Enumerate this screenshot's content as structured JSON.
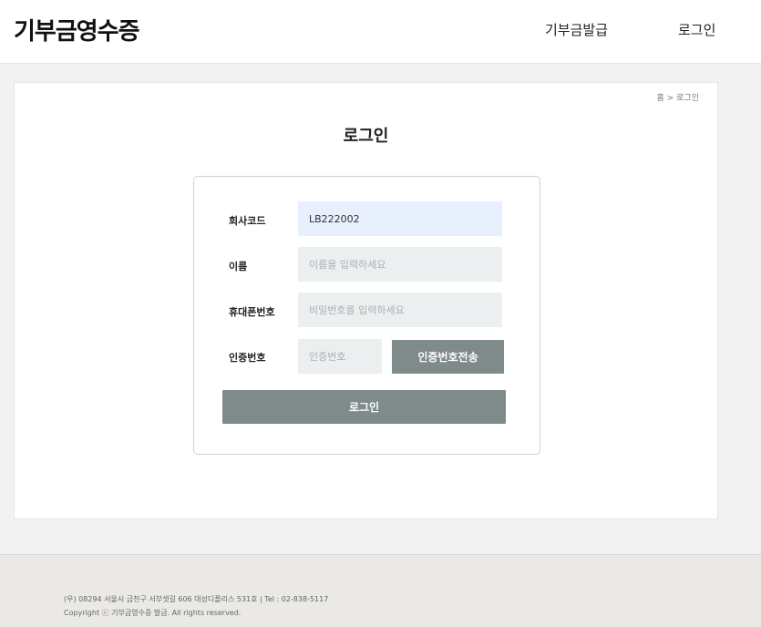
{
  "header": {
    "logo": "기부금영수증",
    "nav": {
      "issue": "기부금발급",
      "login": "로그인"
    }
  },
  "breadcrumb": "홈 > 로그인",
  "page_title": "로그인",
  "form": {
    "company_code": {
      "label": "회사코드",
      "value": "LB222002"
    },
    "name": {
      "label": "이름",
      "placeholder": "이름을 입력하세요"
    },
    "phone": {
      "label": "휴대폰번호",
      "placeholder": "비밀번호를 입력하세요"
    },
    "auth": {
      "label": "인증번호",
      "placeholder": "인증번호",
      "send_label": "인증번호전송"
    },
    "login_label": "로그인"
  },
  "footer": {
    "address": "(우) 08294 서울시 금천구 서부샛길 606 대성디폴리스 531호 | Tel : 02-838-5117",
    "copyright": "Copyright ⓒ 기부금영수증 발급. All rights reserved."
  }
}
